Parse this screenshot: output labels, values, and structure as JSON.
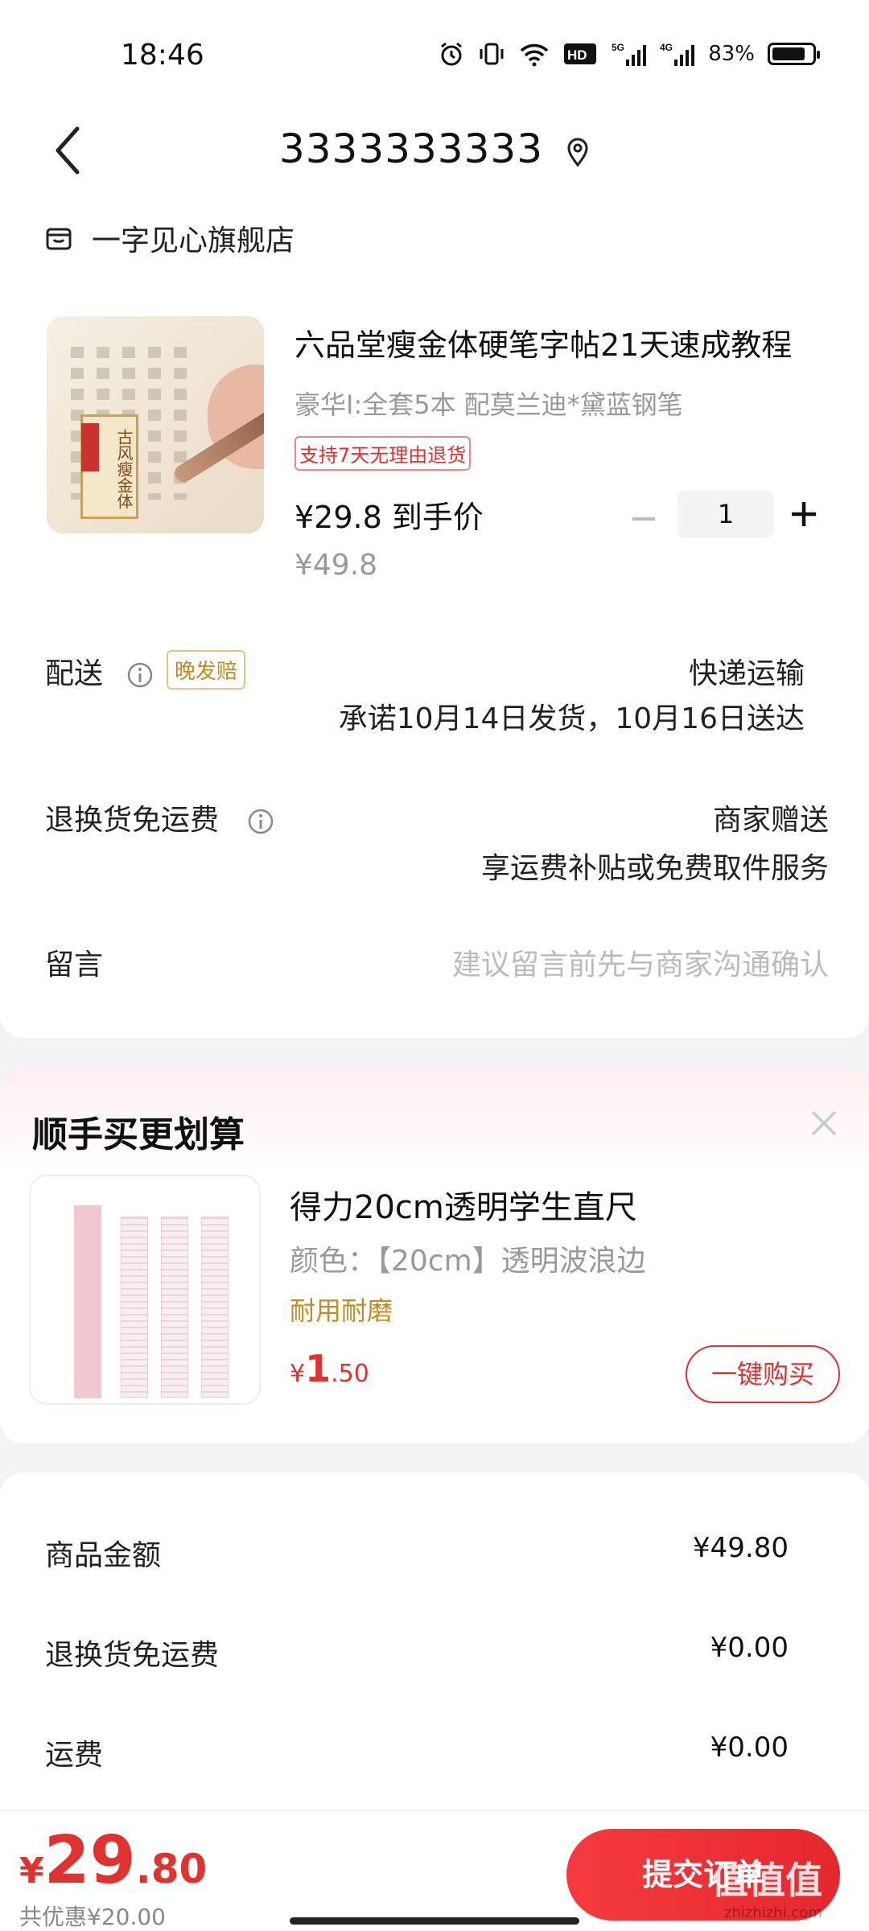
{
  "status_bar": {
    "time": "18:46",
    "battery": "83%",
    "battery_level": 0.83
  },
  "header": {
    "title": "3333333333"
  },
  "store": {
    "name": "一字见心旗舰店"
  },
  "product": {
    "title": "六品堂瘦金体硬笔字帖21天速成教程",
    "sku": "豪华I:全套5本 配莫兰迪*黛蓝钢笔",
    "tag": "支持7天无理由退货",
    "price": "¥29.8 到手价",
    "original_price": "¥49.8",
    "quantity": "1",
    "image_text": "古风瘦金体"
  },
  "delivery": {
    "label": "配送",
    "late_tag": "晚发赔",
    "method": "快递运输",
    "promise": "承诺10月14日发货，10月16日送达"
  },
  "return_shipping": {
    "label": "退换货免运费",
    "value": "商家赠送",
    "detail": "享运费补贴或免费取件服务"
  },
  "message": {
    "label": "留言",
    "placeholder": "建议留言前先与商家沟通确认"
  },
  "upsell": {
    "title": "顺手买更划算",
    "name": "得力20cm透明学生直尺",
    "spec": "颜色：【20cm】透明波浪边",
    "feature": "耐用耐磨",
    "price_currency": "¥",
    "price_int": "1",
    "price_dec": ".50",
    "buy_label": "一键购买"
  },
  "amounts": [
    {
      "label": "商品金额",
      "value": "¥49.80"
    },
    {
      "label": "退换货免运费",
      "value": "¥0.00"
    },
    {
      "label": "运费",
      "value": "¥0.00"
    }
  ],
  "bottom": {
    "currency": "¥",
    "total_int": "29",
    "total_dec": ".80",
    "saved": "共优惠¥20.00",
    "submit_label": "提交订单",
    "watermark": "值值值",
    "watermark_sub": "zhizhizhi.com"
  },
  "colors": {
    "accent": "#e0322f",
    "gold": "#c58a22",
    "muted": "#999999"
  }
}
